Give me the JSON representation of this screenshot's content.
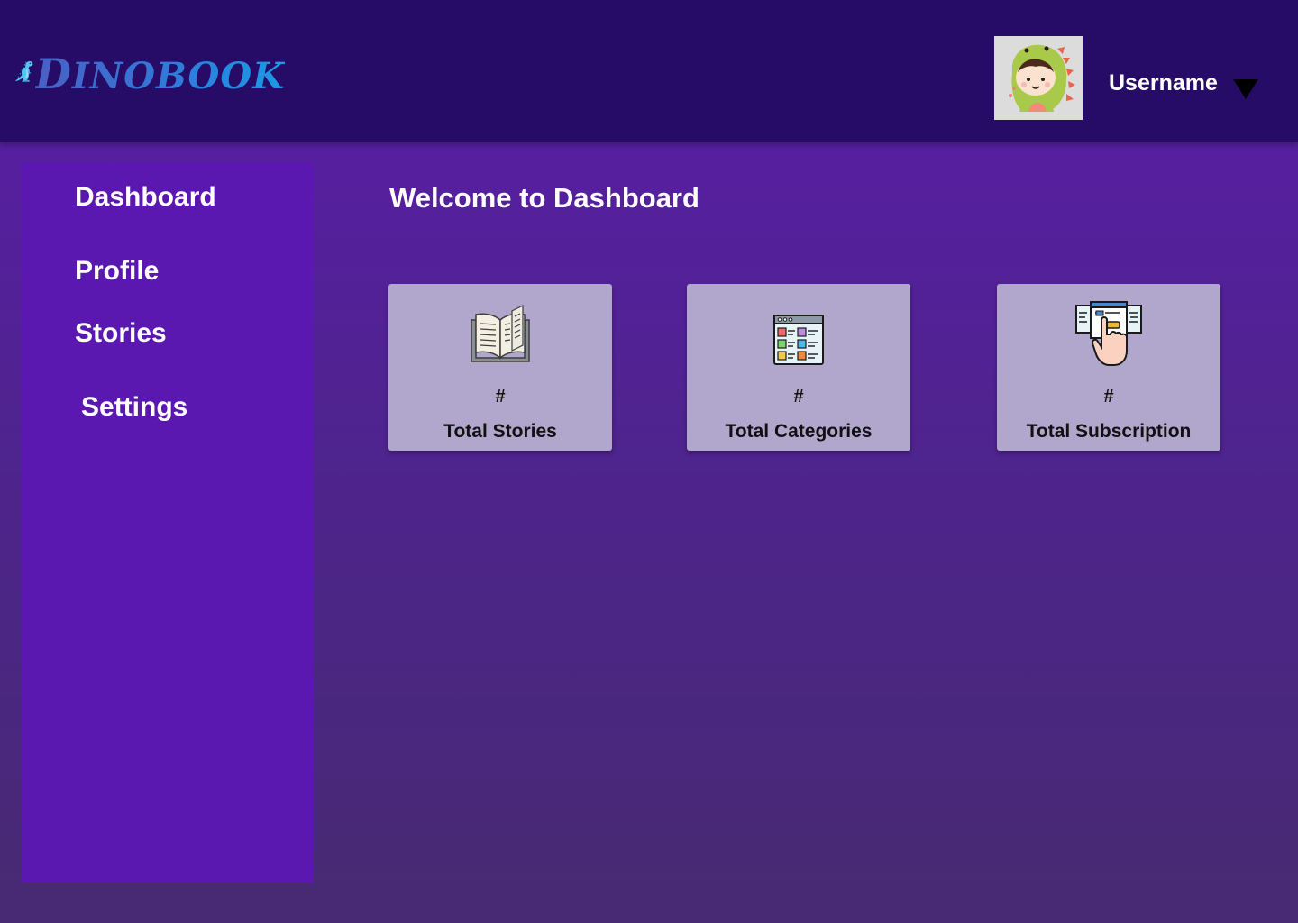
{
  "header": {
    "logo_text_first": "D",
    "logo_text_rest": "INOBOOK",
    "username": "Username"
  },
  "sidebar": {
    "items": [
      {
        "label": "Dashboard"
      },
      {
        "label": "Profile"
      },
      {
        "label": "Stories"
      },
      {
        "label": "Settings"
      }
    ]
  },
  "main": {
    "title": "Welcome to Dashboard",
    "cards": [
      {
        "count": "#",
        "label": "Total Stories",
        "icon": "open-book-icon"
      },
      {
        "count": "#",
        "label": "Total Categories",
        "icon": "category-list-icon"
      },
      {
        "count": "#",
        "label": "Total Subscription",
        "icon": "subscription-hand-icon"
      }
    ]
  },
  "colors": {
    "header_bg": "#260c66",
    "sidebar_bg": "#5a18b0",
    "card_bg": "#b1a6cc",
    "logo_blue": "#2f7ddb"
  }
}
